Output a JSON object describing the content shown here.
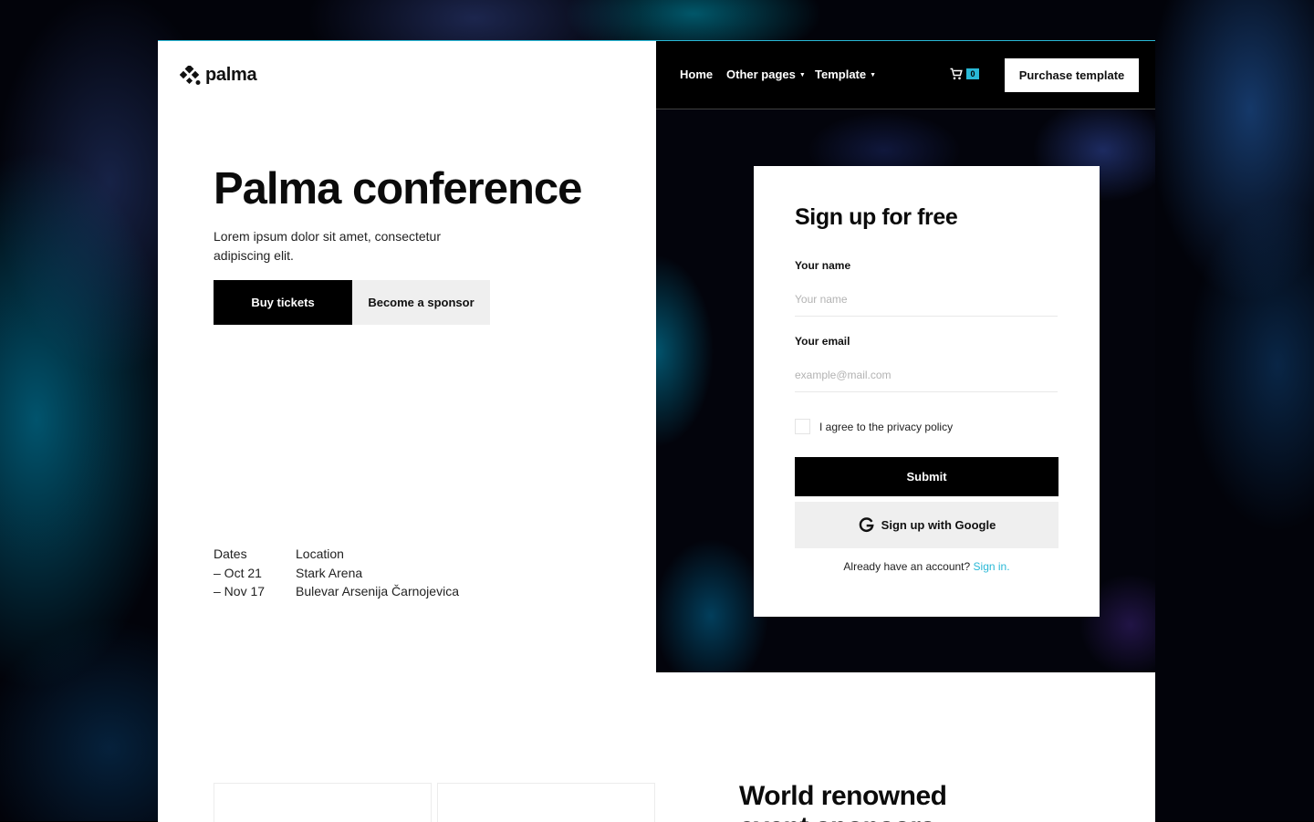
{
  "brand": {
    "name": "palma",
    "accent": "#29b8d6"
  },
  "nav": {
    "items": [
      {
        "label": "Home",
        "has_dropdown": false
      },
      {
        "label": "Other pages",
        "has_dropdown": true
      },
      {
        "label": "Template",
        "has_dropdown": true
      }
    ],
    "cart_count": "0",
    "purchase_label": "Purchase template"
  },
  "hero": {
    "title": "Palma conference",
    "description": "Lorem ipsum dolor sit amet, consectetur adipiscing elit.",
    "primary_button": "Buy tickets",
    "secondary_button": "Become a sponsor"
  },
  "event_info": {
    "dates_heading": "Dates",
    "dates": [
      "– Oct 21",
      "– Nov 17"
    ],
    "location_heading": "Location",
    "location_lines": [
      "Stark Arena",
      "Bulevar Arsenija Čarnojevica"
    ]
  },
  "signup": {
    "title": "Sign up for free",
    "name_label": "Your name",
    "name_placeholder": "Your name",
    "email_label": "Your email",
    "email_placeholder": "example@mail.com",
    "privacy_label": "I agree to the privacy policy",
    "submit_label": "Submit",
    "google_label": "Sign up with Google",
    "existing_account_text": "Already have an account?",
    "signin_link": "Sign in."
  },
  "sponsors": {
    "heading": "World renowned event sponsors"
  }
}
